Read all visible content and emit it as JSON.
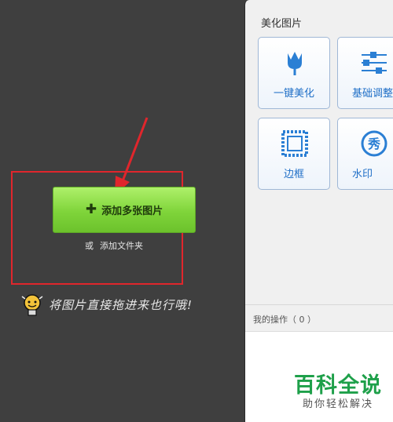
{
  "left": {
    "add_button_label": "添加多张图片",
    "folder_prefix": "或",
    "folder_link": "添加文件夹",
    "hint": "将图片直接拖进来也行哦!"
  },
  "panel": {
    "title": "美化图片",
    "tiles": [
      {
        "label": "一键美化",
        "icon": "tulip-icon"
      },
      {
        "label": "基础调整",
        "icon": "sliders-icon"
      },
      {
        "label": "边框",
        "icon": "frame-icon"
      },
      {
        "label": "水印",
        "icon": "watermark-icon"
      }
    ]
  },
  "ops": {
    "label": "我的操作（ 0 ）"
  },
  "watermark": {
    "main": "百科全说",
    "sub": "助你轻松解决"
  },
  "colors": {
    "accent": "#1f6fc7",
    "button_green": "#7fd43a",
    "highlight_red": "#e0262c",
    "watermark_green": "#1ea04a"
  }
}
